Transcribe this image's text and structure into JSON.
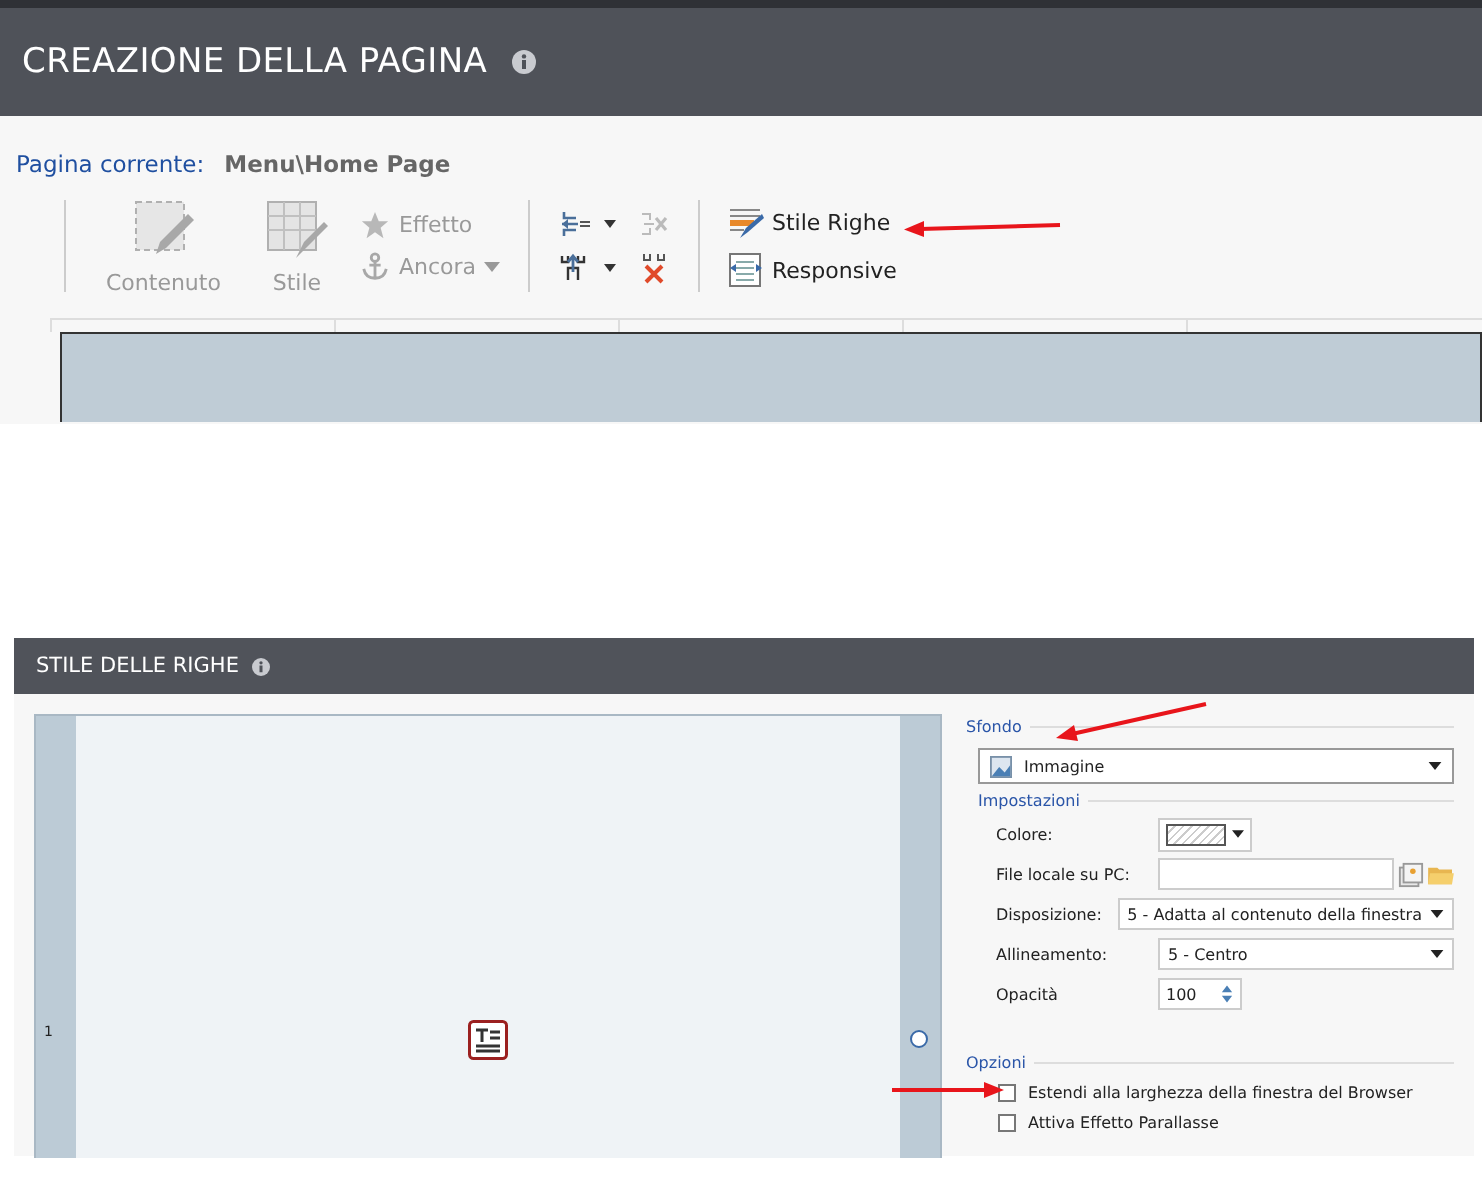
{
  "page_header": {
    "title": "CREAZIONE DELLA PAGINA"
  },
  "current_page": {
    "label": "Pagina corrente:",
    "value": "Menu\\Home Page"
  },
  "toolbar": {
    "large": [
      {
        "label": "Contenuto",
        "kind": "pencil",
        "disabled": true
      },
      {
        "label": "Stile",
        "kind": "table-brush",
        "disabled": true
      }
    ],
    "small": [
      {
        "label": "Effetto",
        "kind": "star",
        "disabled": true,
        "dropdown": false
      },
      {
        "label": "Ancora",
        "kind": "anchor",
        "disabled": true,
        "dropdown": true
      }
    ],
    "actions": [
      {
        "label": "Stile Righe",
        "kind": "brush"
      },
      {
        "label": "Responsive",
        "kind": "responsive"
      }
    ]
  },
  "dialog": {
    "title": "STILE DELLE RIGHE",
    "row_number": "1",
    "background": {
      "heading": "Sfondo",
      "value": "Immagine"
    },
    "settings": {
      "heading": "Impostazioni",
      "fields": [
        {
          "kind": "color",
          "label": "Colore:"
        },
        {
          "kind": "file",
          "label": "File locale su PC:"
        },
        {
          "kind": "select",
          "label": "Disposizione:",
          "value": "5 - Adatta al contenuto della finestra"
        },
        {
          "kind": "select",
          "label": "Allineamento:",
          "value": "5 - Centro"
        },
        {
          "kind": "spinner",
          "label": "Opacità",
          "value": "100"
        }
      ]
    },
    "options": {
      "heading": "Opzioni",
      "items": [
        {
          "label": "Estendi alla larghezza della finestra del Browser",
          "checked": false
        },
        {
          "label": "Attiva Effetto Parallasse",
          "checked": false
        }
      ]
    }
  }
}
